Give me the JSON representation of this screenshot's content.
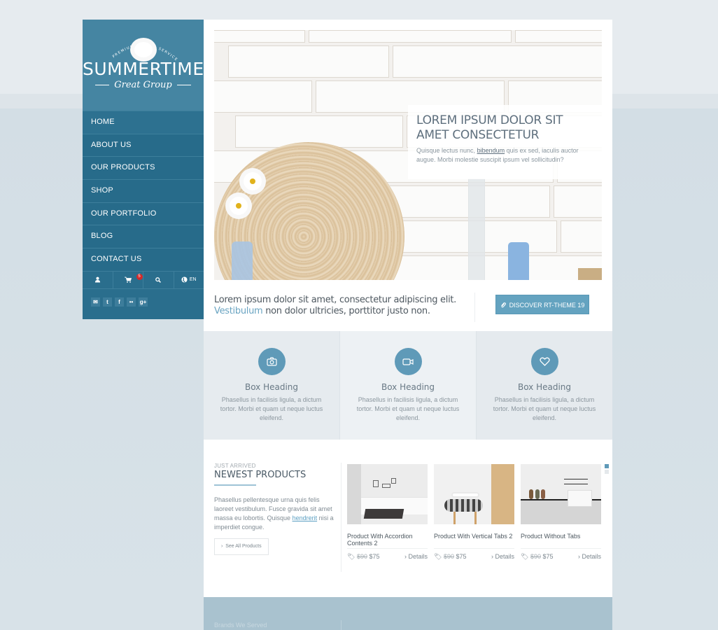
{
  "logo": {
    "tagline_arc": "PREMIUM UNIQUE SERVICES",
    "brand": "SUMMERTIME",
    "subtitle": "Great Group"
  },
  "nav": {
    "items": [
      {
        "label": "HOME"
      },
      {
        "label": "ABOUT US"
      },
      {
        "label": "OUR PRODUCTS"
      },
      {
        "label": "SHOP"
      },
      {
        "label": "OUR PORTFOLIO"
      },
      {
        "label": "BLOG"
      },
      {
        "label": "CONTACT US"
      }
    ]
  },
  "toolbar": {
    "user_icon": "user-icon",
    "cart_icon": "cart-icon",
    "cart_count": "5",
    "search_icon": "search-icon",
    "language_icon": "globe-icon",
    "language": "EN"
  },
  "social": [
    {
      "icon": "mail-icon",
      "glyph": "✉"
    },
    {
      "icon": "twitter-icon",
      "glyph": "t"
    },
    {
      "icon": "facebook-icon",
      "glyph": "f"
    },
    {
      "icon": "flickr-icon",
      "glyph": "••"
    },
    {
      "icon": "google-plus-icon",
      "glyph": "g+"
    }
  ],
  "hero": {
    "title": "LOREM IPSUM DOLOR SIT AMET CONSECTETUR",
    "text_before": "Quisque lectus nunc, ",
    "link": "bibendum",
    "text_after": " quis ex sed, iaculis auctor augue. Morbi molestie suscipit ipsum vel sollicitudin?"
  },
  "promo": {
    "line1": "Lorem ipsum dolor sit amet, consectetur adipiscing elit.",
    "link": "Vestibulum",
    "line2_rest": " non dolor ultricies, porttitor justo non.",
    "button_label": "DISCOVER RT-THEME 19",
    "button_icon": "paperclip-icon"
  },
  "boxes": [
    {
      "icon": "camera-icon",
      "heading": "Box Heading",
      "text": "Phasellus in facilisis ligula, a dictum tortor. Morbi et quam ut neque luctus eleifend."
    },
    {
      "icon": "video-camera-icon",
      "heading": "Box Heading",
      "text": "Phasellus in facilisis ligula, a dictum tortor. Morbi et quam ut neque luctus eleifend."
    },
    {
      "icon": "heart-icon",
      "heading": "Box Heading",
      "text": "Phasellus in facilisis ligula, a dictum tortor. Morbi et quam ut neque luctus eleifend."
    }
  ],
  "newest": {
    "kicker": "JUST ARRIVED",
    "title": "NEWEST PRODUCTS",
    "text_before": "Phasellus pellentesque urna quis felis laoreet vestibulum. Fusce gravida sit amet massa eu lobortis. Quisque ",
    "link": "hendrerit",
    "text_after": " nisi a imperdiet congue.",
    "see_all": "See All Products"
  },
  "products": [
    {
      "name": "Product With Accordion Contents 2",
      "old_price": "$90",
      "price": "$75",
      "details": "Details"
    },
    {
      "name": "Product With Vertical Tabs 2",
      "old_price": "$90",
      "price": "$75",
      "details": "Details"
    },
    {
      "name": "Product Without Tabs",
      "old_price": "$90",
      "price": "$75",
      "details": "Details"
    }
  ],
  "slider": {
    "pages": 2,
    "active": 1
  },
  "brands": {
    "title": "Brands We Served"
  }
}
